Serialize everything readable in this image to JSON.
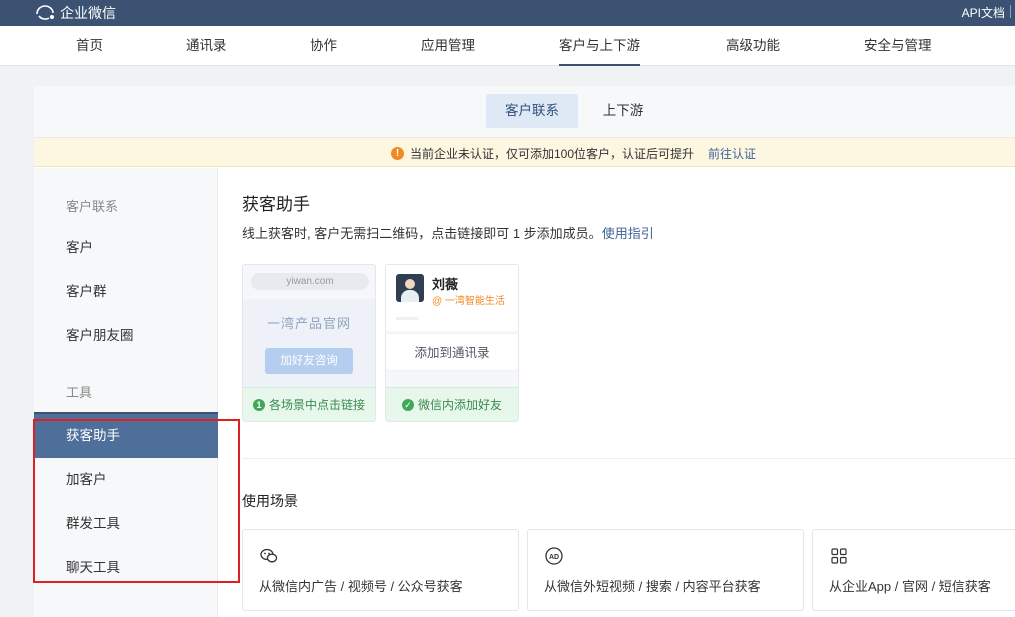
{
  "brand": {
    "name": "企业微信"
  },
  "topbar": {
    "api_docs": "API文档"
  },
  "nav": {
    "items": [
      {
        "label": "首页"
      },
      {
        "label": "通讯录"
      },
      {
        "label": "协作"
      },
      {
        "label": "应用管理"
      },
      {
        "label": "客户与上下游",
        "active": true
      },
      {
        "label": "高级功能"
      },
      {
        "label": "安全与管理"
      }
    ]
  },
  "subtabs": [
    {
      "label": "客户联系",
      "active": true
    },
    {
      "label": "上下游"
    }
  ],
  "notice": {
    "text": "当前企业未认证，仅可添加100位客户，认证后可提升",
    "link": "前往认证"
  },
  "sidebar": {
    "group1_heading": "客户联系",
    "group1_items": [
      {
        "label": "客户"
      },
      {
        "label": "客户群"
      },
      {
        "label": "客户朋友圈"
      }
    ],
    "group2_heading": "工具",
    "group2_items": [
      {
        "label": "获客助手",
        "active": true
      },
      {
        "label": "加客户"
      },
      {
        "label": "群发工具"
      },
      {
        "label": "聊天工具"
      }
    ]
  },
  "main": {
    "title": "获客助手",
    "description": "线上获客时, 客户无需扫二维码，点击链接即可 1 步添加成员。",
    "guide_link": "使用指引",
    "demo1": {
      "url": "yiwan.com",
      "site_title": "一湾产品官网",
      "button": "加好友咨询",
      "step_number": "1",
      "footer": "各场景中点击链接"
    },
    "demo2": {
      "name": "刘薇",
      "org": "@ 一湾智能生活",
      "add_label": "添加到通讯录",
      "footer": "微信内添加好友"
    },
    "scenes_title": "使用场景",
    "scenes": [
      {
        "icon": "wechat-icon",
        "label": "从微信内广告 / 视频号 / 公众号获客"
      },
      {
        "icon": "ad-icon",
        "label": "从微信外短视频 / 搜索 / 内容平台获客"
      },
      {
        "icon": "app-grid-icon",
        "label": "从企业App / 官网 / 短信获客"
      }
    ]
  }
}
